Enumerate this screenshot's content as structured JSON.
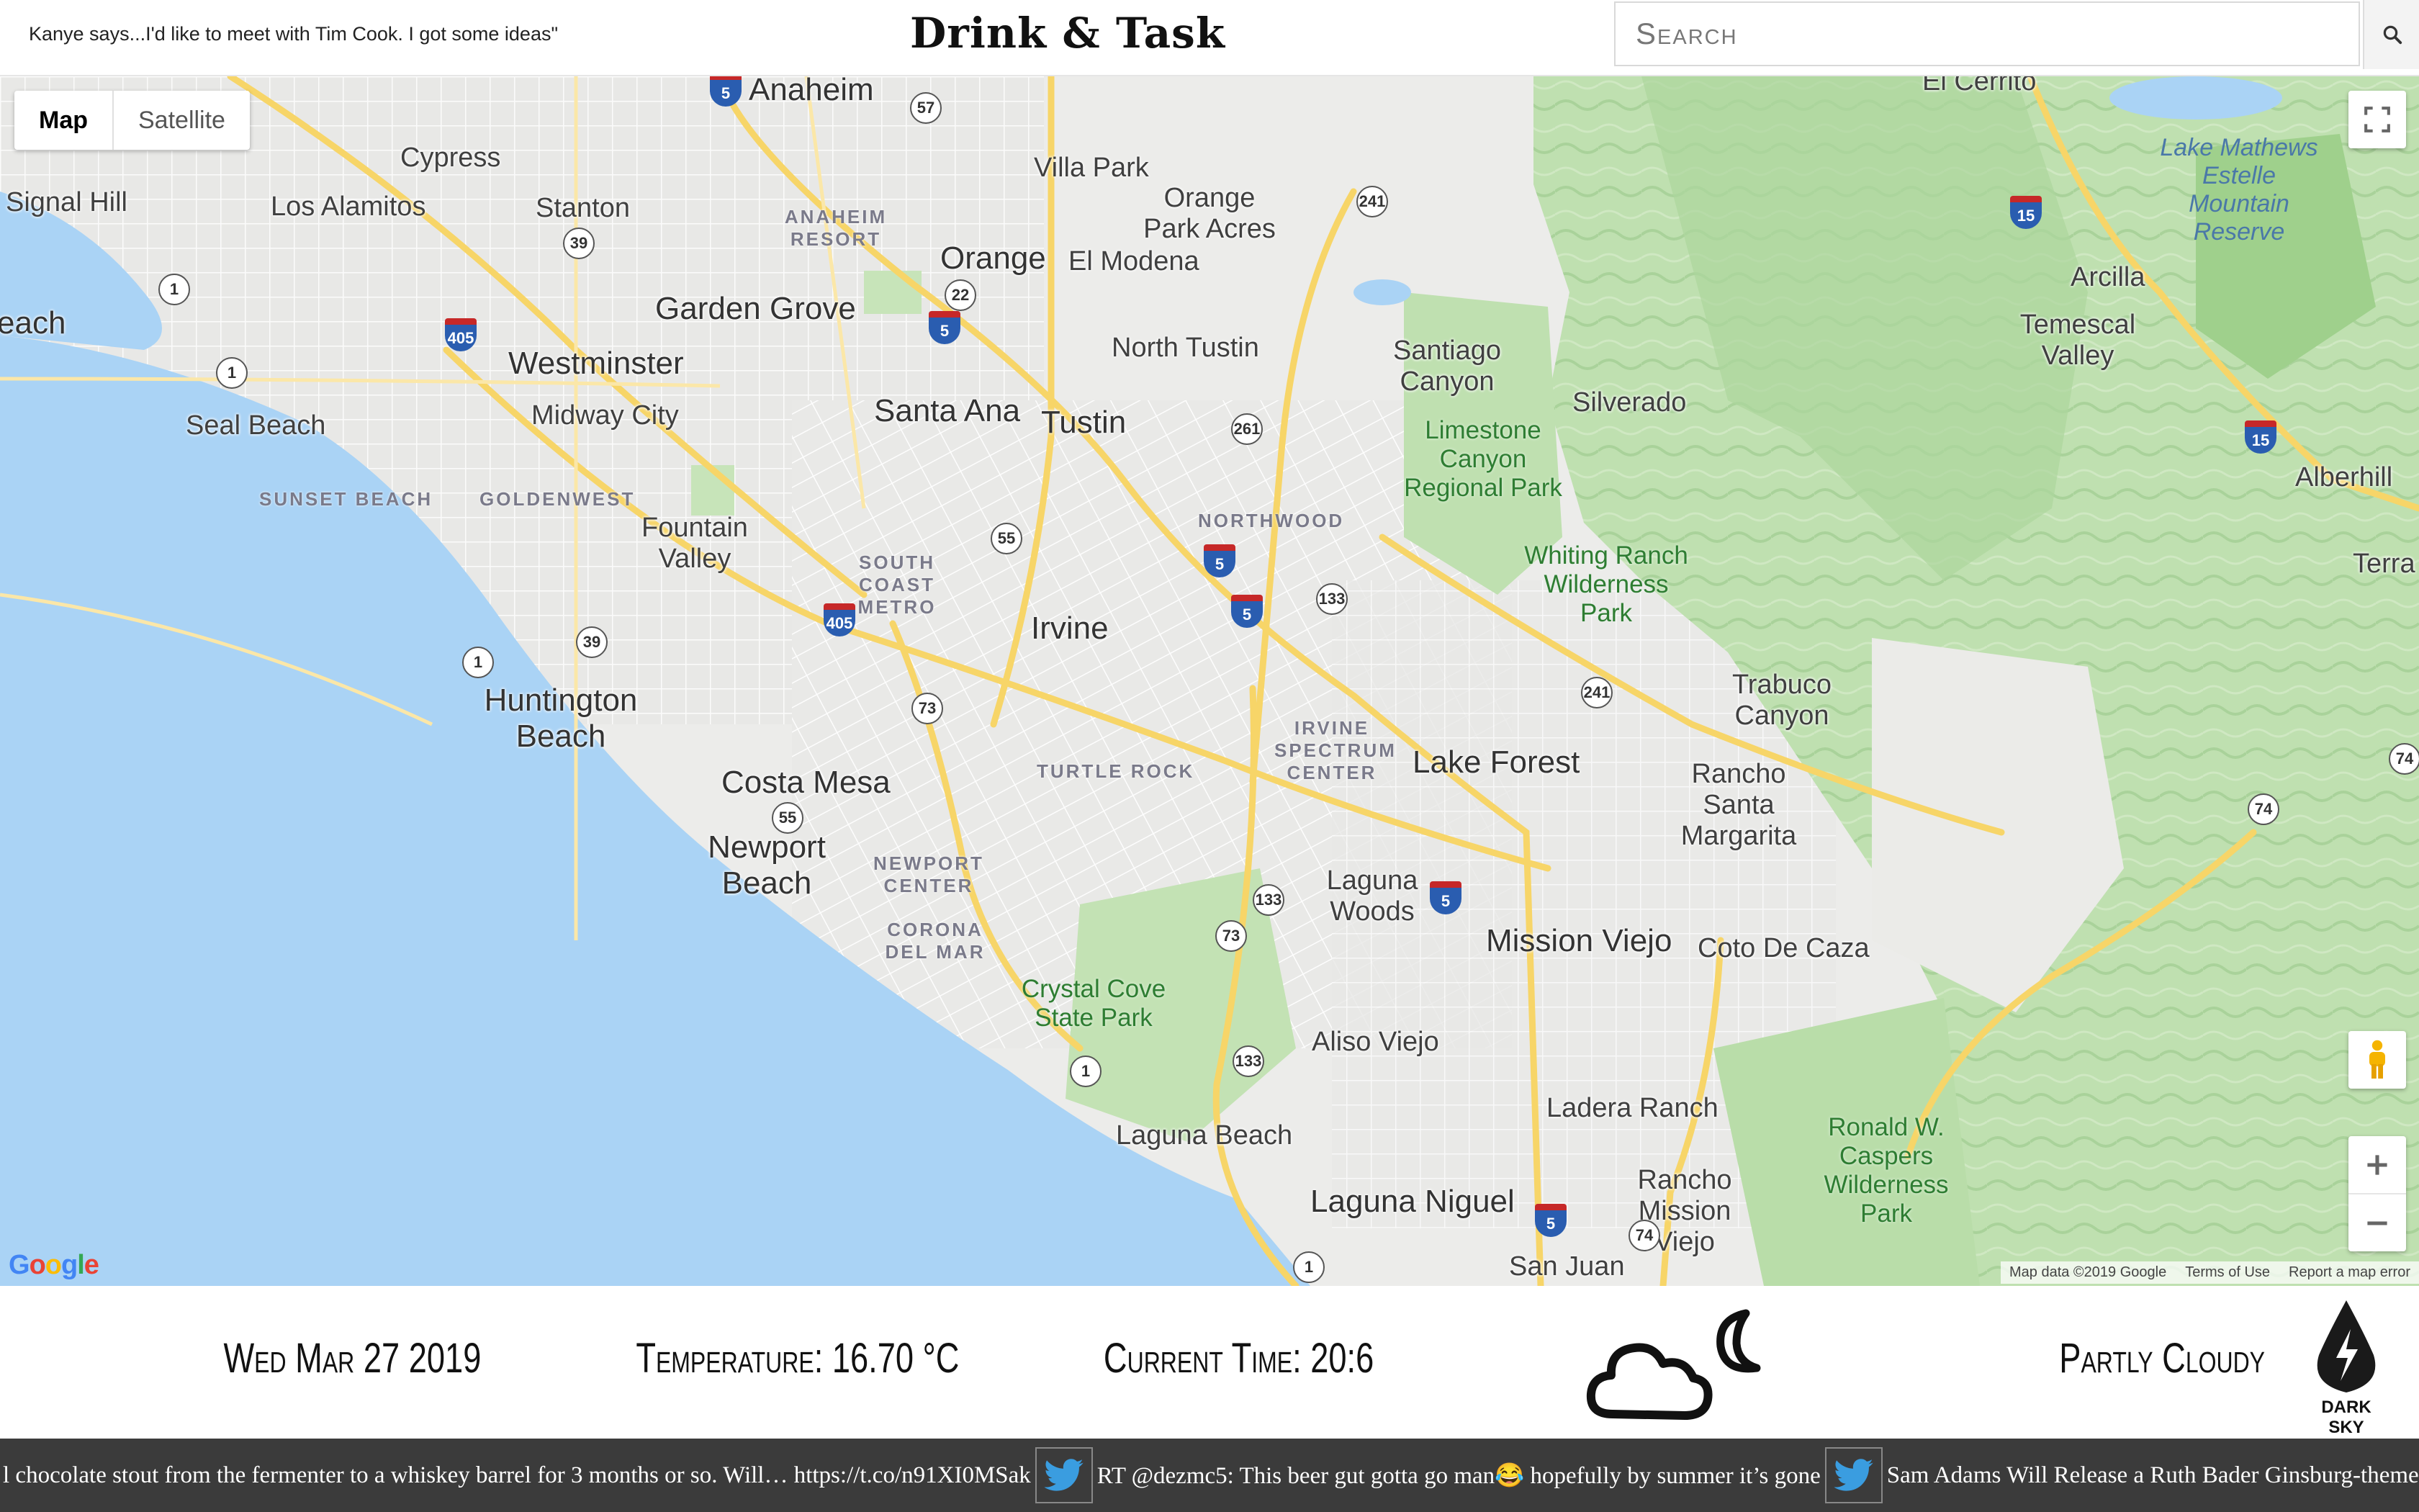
{
  "header": {
    "quote": "Kanye says...I'd like to meet with Tim Cook. I got some ideas\"",
    "brand": "Drink & Task",
    "search_placeholder": "Search"
  },
  "map": {
    "type_controls": [
      "Map",
      "Satellite"
    ],
    "google_logo": "Google",
    "attribution": [
      "Map data ©2019 Google",
      "Terms of Use",
      "Report a map error"
    ],
    "labels": {
      "anaheim": "Anaheim",
      "cypress": "Cypress",
      "signal_hill": "Signal Hill",
      "los_alamitos": "Los Alamitos",
      "stanton": "Stanton",
      "anaheim_resort": "ANAHEIM RESORT",
      "villa_park": "Villa Park",
      "orange_park_acres": "Orange Park Acres",
      "orange": "Orange",
      "el_modena": "El Modena",
      "beach_edge": "each",
      "garden_grove": "Garden Grove",
      "westminster": "Westminster",
      "north_tustin": "North Tustin",
      "santiago_canyon": "Santiago Canyon",
      "silverado": "Silverado",
      "seal_beach": "Seal Beach",
      "midway_city": "Midway City",
      "santa_ana": "Santa Ana",
      "tustin": "Tustin",
      "limestone": "Limestone Canyon Regional Park",
      "sunset_beach": "SUNSET BEACH",
      "goldenwest": "GOLDENWEST",
      "northwood": "NORTHWOOD",
      "fountain_valley": "Fountain Valley",
      "south_coast_metro": "SOUTH COAST METRO",
      "whiting_ranch": "Whiting Ranch Wilderness Park",
      "irvine": "Irvine",
      "huntington_beach": "Huntington Beach",
      "trabuco_canyon": "Trabuco Canyon",
      "irvine_spectrum": "IRVINE SPECTRUM CENTER",
      "lake_forest": "Lake Forest",
      "rancho_santa_margarita": "Rancho Santa Margarita",
      "costa_mesa": "Costa Mesa",
      "turtle_rock": "TURTLE ROCK",
      "newport_beach": "Newport Beach",
      "newport_center": "NEWPORT CENTER",
      "laguna_woods": "Laguna Woods",
      "mission_viejo": "Mission Viejo",
      "coto_de_caza": "Coto De Caza",
      "corona_del_mar": "CORONA DEL MAR",
      "crystal_cove": "Crystal Cove State Park",
      "aliso_viejo": "Aliso Viejo",
      "ladera_ranch": "Ladera Ranch",
      "ronald_caspers": "Ronald W. Caspers Wilderness Park",
      "laguna_beach": "Laguna Beach",
      "rancho_mission_viejo": "Rancho Mission Viejo",
      "laguna_niguel": "Laguna Niguel",
      "san_juan": "San Juan",
      "el_cerrito": "El Cerrito",
      "lake_mathews": "Lake Mathews Estelle Mountain Reserve",
      "arcilla": "Arcilla",
      "temescal_valley": "Temescal Valley",
      "alberhill": "Alberhill",
      "terra": "Terra C"
    },
    "shields": [
      "5",
      "57",
      "241",
      "15",
      "39",
      "1",
      "22",
      "5",
      "405",
      "1",
      "261",
      "15",
      "55",
      "5",
      "5",
      "133",
      "405",
      "39",
      "1",
      "241",
      "73",
      "74",
      "55",
      "74",
      "133",
      "5",
      "73",
      "1",
      "133",
      "5",
      "74",
      "1"
    ]
  },
  "weather": {
    "date": "Wed Mar 27 2019",
    "temperature": "Temperature: 16.70 °C",
    "time": "Current Time: 20:6",
    "summary": "Partly Cloudy",
    "icon": "partly-cloudy-night-icon",
    "provider": "DARK SKY"
  },
  "ticker": {
    "items": [
      "l chocolate stout from the fermenter to a whiskey barrel for 3 months or so. Will… https://t.co/n91XI0MSak",
      "RT @dezmc5: This beer gut gotta go man😂  hopefully by summer it’s gone",
      "Sam Adams Will Release a Ruth Bader Ginsburg-themed Beer htt"
    ]
  }
}
